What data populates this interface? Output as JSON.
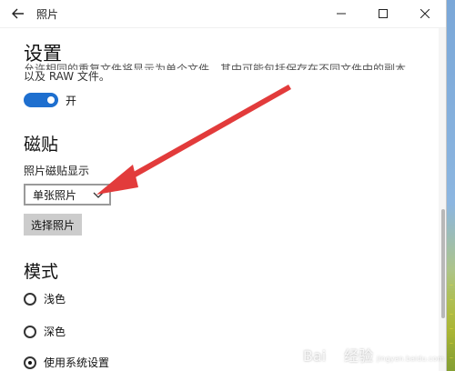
{
  "window": {
    "title": "照片",
    "back_icon": "back-arrow-icon",
    "minimize_icon": "minimize-icon",
    "maximize_icon": "maximize-icon",
    "close_icon": "close-icon"
  },
  "settings": {
    "heading": "设置",
    "description_cut": "允许相同的重复文件将显示为单个文件。其中可能包括保存在不同文件中的副本",
    "description_line": "以及 RAW 文件。",
    "toggle_label": "开",
    "toggle_on": true
  },
  "tiles": {
    "heading": "磁贴",
    "field_label": "照片磁贴显示",
    "selected": "单张照片",
    "button_label": "选择照片"
  },
  "mode": {
    "heading": "模式",
    "options": [
      {
        "label": "浅色",
        "checked": false
      },
      {
        "label": "深色",
        "checked": false
      },
      {
        "label": "使用系统设置",
        "checked": true
      }
    ]
  },
  "annotation": {
    "arrow_color": "#e23b3b"
  },
  "watermark": {
    "brand": "Bai",
    "suffix": "经验",
    "url": "jingyan.baidu.com"
  },
  "colors": {
    "accent": "#1e6fcf"
  }
}
